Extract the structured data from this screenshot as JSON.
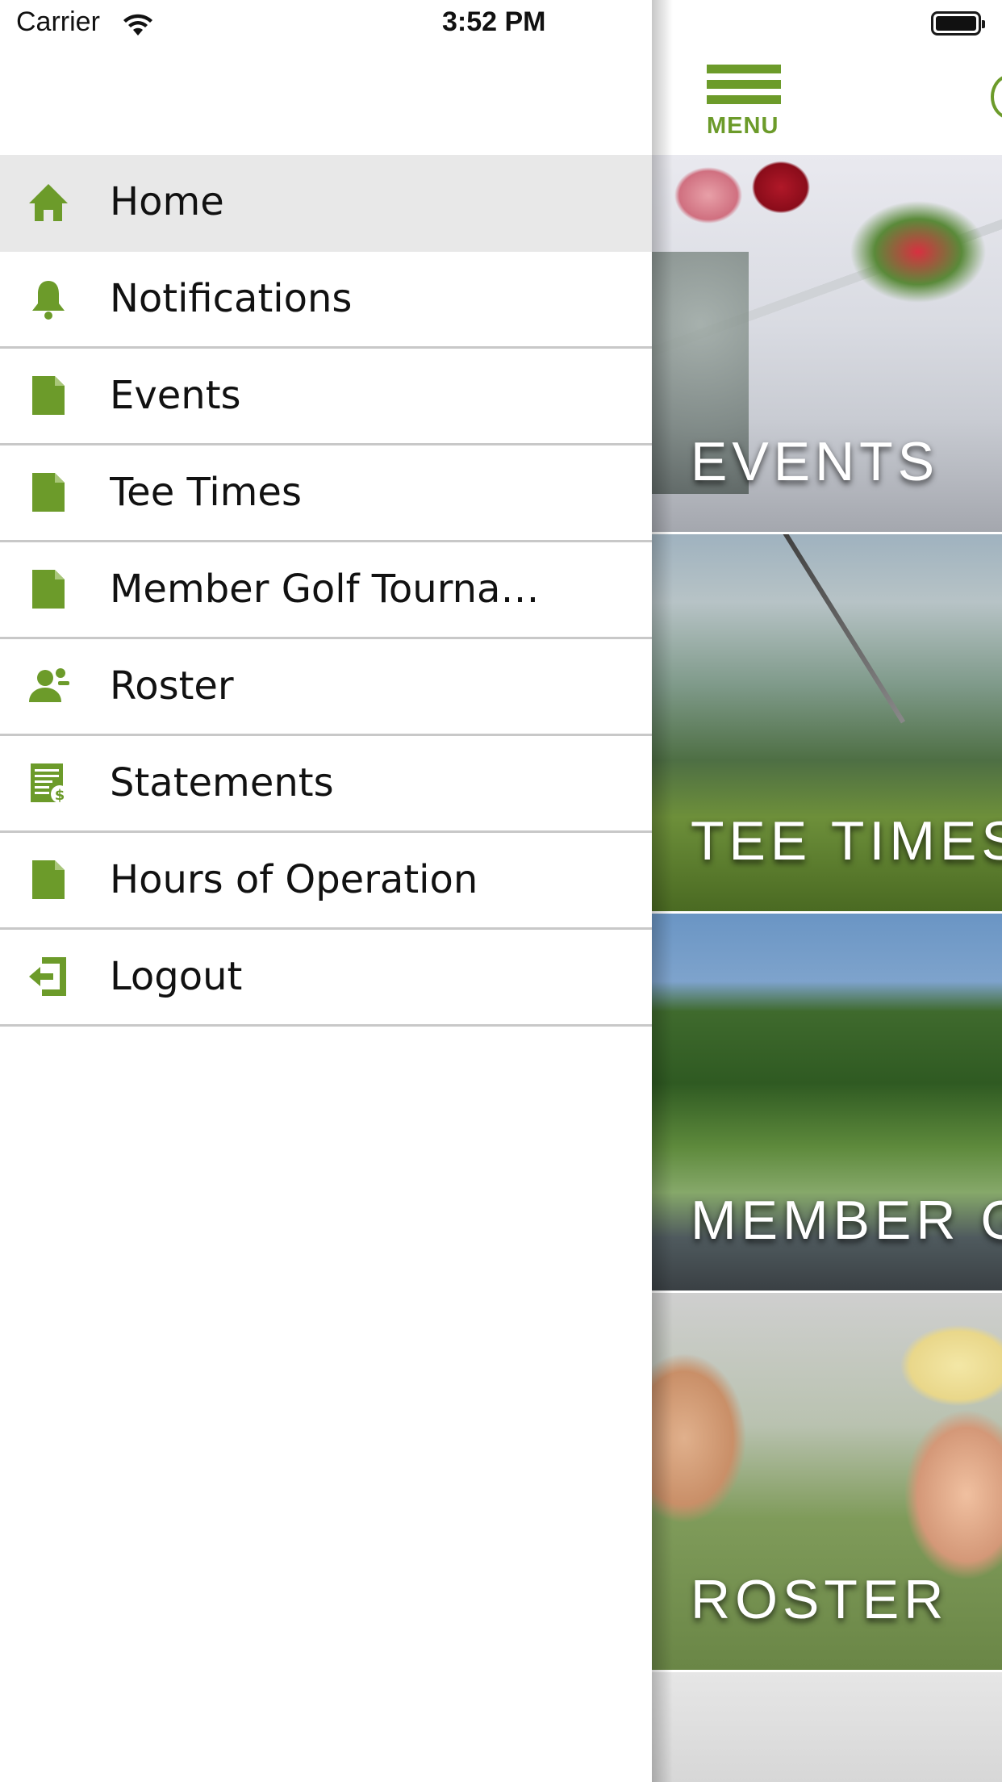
{
  "status_bar": {
    "carrier": "Carrier",
    "time": "3:52 PM"
  },
  "header": {
    "menu_label": "MENU"
  },
  "menu": {
    "items": [
      {
        "label": "Home",
        "icon": "home-icon",
        "active": true
      },
      {
        "label": "Notifications",
        "icon": "bell-icon"
      },
      {
        "label": "Events",
        "icon": "document-icon"
      },
      {
        "label": "Tee Times",
        "icon": "document-icon"
      },
      {
        "label": "Member Golf Tournam…",
        "icon": "document-icon"
      },
      {
        "label": "Roster",
        "icon": "person-icon"
      },
      {
        "label": "Statements",
        "icon": "statement-icon"
      },
      {
        "label": "Hours of Operation",
        "icon": "document-icon"
      },
      {
        "label": "Logout",
        "icon": "logout-icon"
      }
    ]
  },
  "tiles": [
    {
      "title": "EVENTS"
    },
    {
      "title": "TEE TIMES"
    },
    {
      "title": "MEMBER G"
    },
    {
      "title": "ROSTER"
    }
  ],
  "colors": {
    "accent": "#6c9b2a",
    "active_row": "#e8e8e8",
    "divider": "#c8c8c8"
  }
}
